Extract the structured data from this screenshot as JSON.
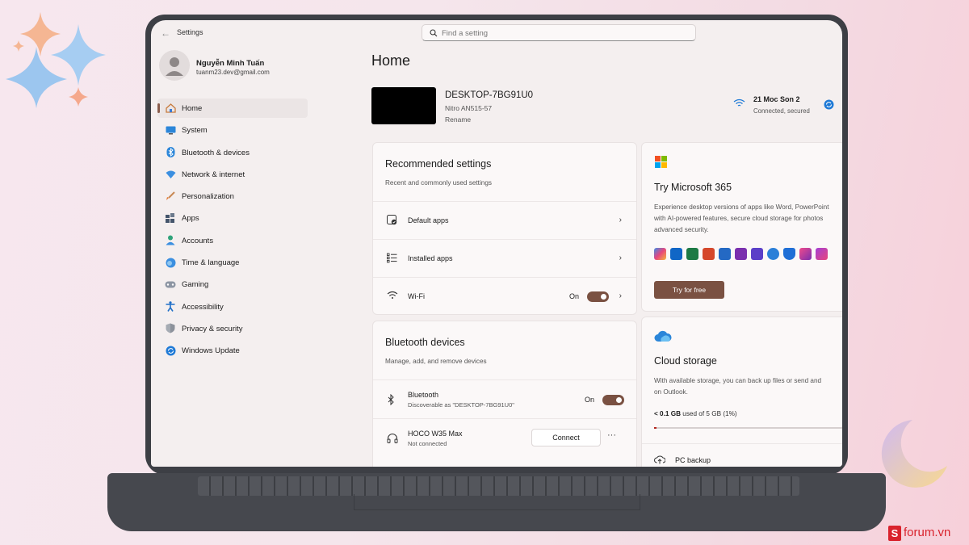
{
  "window": {
    "title": "Settings"
  },
  "search": {
    "placeholder": "Find a setting"
  },
  "profile": {
    "name": "Nguyễn Minh Tuấn",
    "email": "tuanm23.dev@gmail.com"
  },
  "sidebar": {
    "items": [
      {
        "label": "Home",
        "icon": "home-icon",
        "active": true
      },
      {
        "label": "System",
        "icon": "system-icon"
      },
      {
        "label": "Bluetooth & devices",
        "icon": "bluetooth-icon"
      },
      {
        "label": "Network & internet",
        "icon": "wifi-icon"
      },
      {
        "label": "Personalization",
        "icon": "brush-icon"
      },
      {
        "label": "Apps",
        "icon": "apps-icon"
      },
      {
        "label": "Accounts",
        "icon": "accounts-icon"
      },
      {
        "label": "Time & language",
        "icon": "globe-icon"
      },
      {
        "label": "Gaming",
        "icon": "gamepad-icon"
      },
      {
        "label": "Accessibility",
        "icon": "accessibility-icon"
      },
      {
        "label": "Privacy & security",
        "icon": "shield-icon"
      },
      {
        "label": "Windows Update",
        "icon": "update-icon"
      }
    ]
  },
  "main": {
    "title": "Home",
    "device": {
      "name": "DESKTOP-7BG91U0",
      "model": "Nitro AN515-57",
      "rename": "Rename"
    },
    "network": {
      "name": "21 Moc Son 2",
      "status": "Connected, secured"
    },
    "recommended": {
      "title": "Recommended settings",
      "subtitle": "Recent and commonly used settings",
      "rows": [
        {
          "label": "Default apps",
          "icon": "default-apps-icon"
        },
        {
          "label": "Installed apps",
          "icon": "installed-apps-icon"
        },
        {
          "label": "Wi-Fi",
          "icon": "wifi-icon",
          "toggle": "On"
        }
      ]
    },
    "bluetooth": {
      "title": "Bluetooth devices",
      "subtitle": "Manage, add, and remove devices",
      "bt_label": "Bluetooth",
      "bt_sub": "Discoverable as \"DESKTOP-7BG91U0\"",
      "bt_toggle": "On",
      "device_name": "HOCO W35 Max",
      "device_status": "Not connected",
      "connect_label": "Connect",
      "more_label": "···"
    },
    "m365": {
      "title": "Try Microsoft 365",
      "desc_line1": "Experience desktop versions of apps like Word, PowerPoint",
      "desc_line2": "with AI-powered features, secure cloud storage for photos",
      "desc_line3": "advanced security.",
      "button": "Try for free"
    },
    "cloud": {
      "title": "Cloud storage",
      "desc_line1": "With available storage, you can back up files or send and",
      "desc_line2": "on Outlook.",
      "usage_used": "< 0.1 GB",
      "usage_rest": "used of 5 GB (1%)",
      "usage_fraction": 0.01,
      "backup_label": "PC backup"
    }
  },
  "watermark": {
    "s": "S",
    "text": "forum.vn"
  },
  "colors": {
    "accent": "#7a5142",
    "update_blue": "#1f7ad6"
  }
}
